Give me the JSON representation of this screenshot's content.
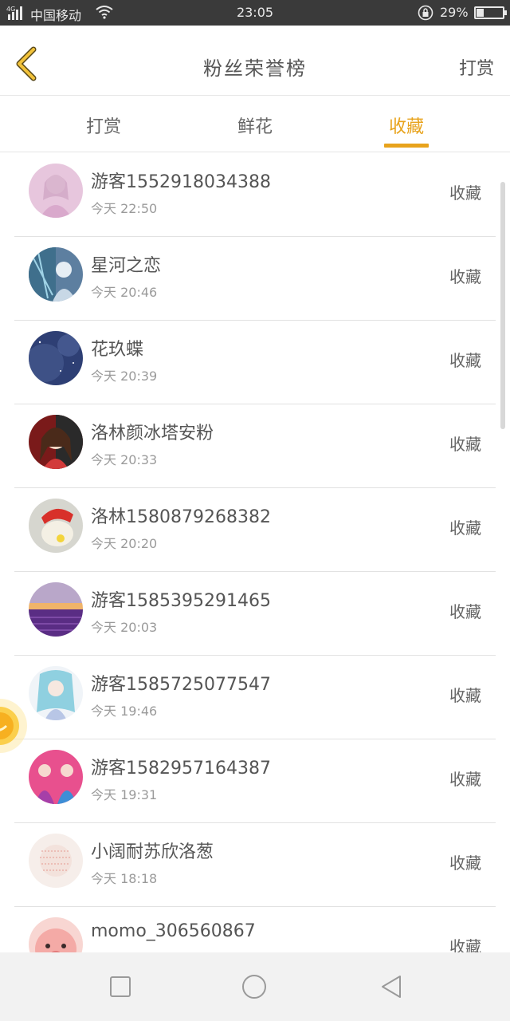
{
  "status_bar": {
    "network": "4G",
    "carrier": "中国移动",
    "time": "23:05",
    "battery": "29%",
    "battery_level": 0.29
  },
  "header": {
    "title": "粉丝荣誉榜",
    "action": "打赏"
  },
  "tabs": [
    {
      "label": "打赏",
      "active": false
    },
    {
      "label": "鲜花",
      "active": false
    },
    {
      "label": "收藏",
      "active": true
    }
  ],
  "accent_color": "#e8a31c",
  "rows": [
    {
      "name": "游客1552918034388",
      "time": "今天 22:50",
      "tag": "收藏"
    },
    {
      "name": "星河之恋",
      "time": "今天 20:46",
      "tag": "收藏"
    },
    {
      "name": "花玖蝶",
      "time": "今天 20:39",
      "tag": "收藏"
    },
    {
      "name": "洛林颜冰塔安粉",
      "time": "今天 20:33",
      "tag": "收藏"
    },
    {
      "name": "洛林1580879268382",
      "time": "今天 20:20",
      "tag": "收藏"
    },
    {
      "name": "游客1585395291465",
      "time": "今天 20:03",
      "tag": "收藏"
    },
    {
      "name": "游客1585725077547",
      "time": "今天 19:46",
      "tag": "收藏"
    },
    {
      "name": "游客1582957164387",
      "time": "今天 19:31",
      "tag": "收藏"
    },
    {
      "name": "小阔耐苏欣洛葱",
      "time": "今天 18:18",
      "tag": "收藏"
    },
    {
      "name": "momo_306560867",
      "time": "",
      "tag": "收藏"
    }
  ],
  "nav": {
    "square": "recent-apps-icon",
    "circle": "home-icon",
    "triangle": "back-icon"
  }
}
